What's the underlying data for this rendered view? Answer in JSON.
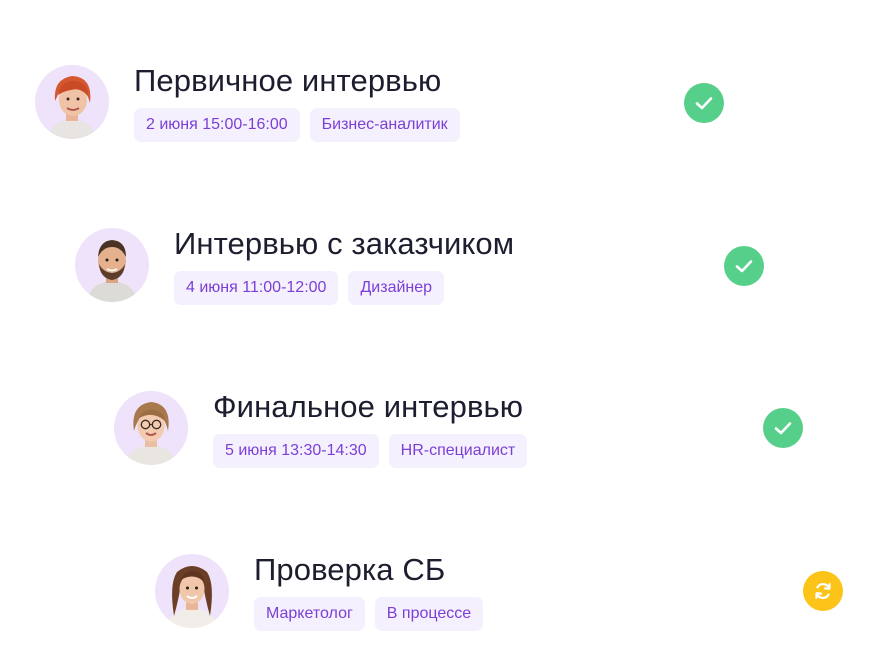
{
  "interviews": [
    {
      "title": "Первичное интервью",
      "date": "2 июня 15:00-16:00",
      "role": "Бизнес-аналитик",
      "status": "completed",
      "avatar": "woman-red-hair-avatar",
      "status_icon": "check-icon"
    },
    {
      "title": "Интервью с заказчиком",
      "date": "4 июня 11:00-12:00",
      "role": "Дизайнер",
      "status": "completed",
      "avatar": "bearded-man-avatar",
      "status_icon": "check-icon"
    },
    {
      "title": "Финальное интервью",
      "date": "5 июня 13:30-14:30",
      "role": "HR-специалист",
      "status": "completed",
      "avatar": "woman-glasses-avatar",
      "status_icon": "check-icon"
    },
    {
      "title": "Проверка СБ",
      "date": "Маркетолог",
      "role": "В процессе",
      "status": "in-progress",
      "avatar": "woman-brown-hair-avatar",
      "status_icon": "refresh-icon"
    }
  ],
  "colors": {
    "avatar_bg": "#efe3fb",
    "tag_bg": "#f5f0fd",
    "tag_text": "#7b3fd6",
    "title_text": "#1c1d2e",
    "done": "#56cf8a",
    "in_progress": "#fcc419"
  }
}
